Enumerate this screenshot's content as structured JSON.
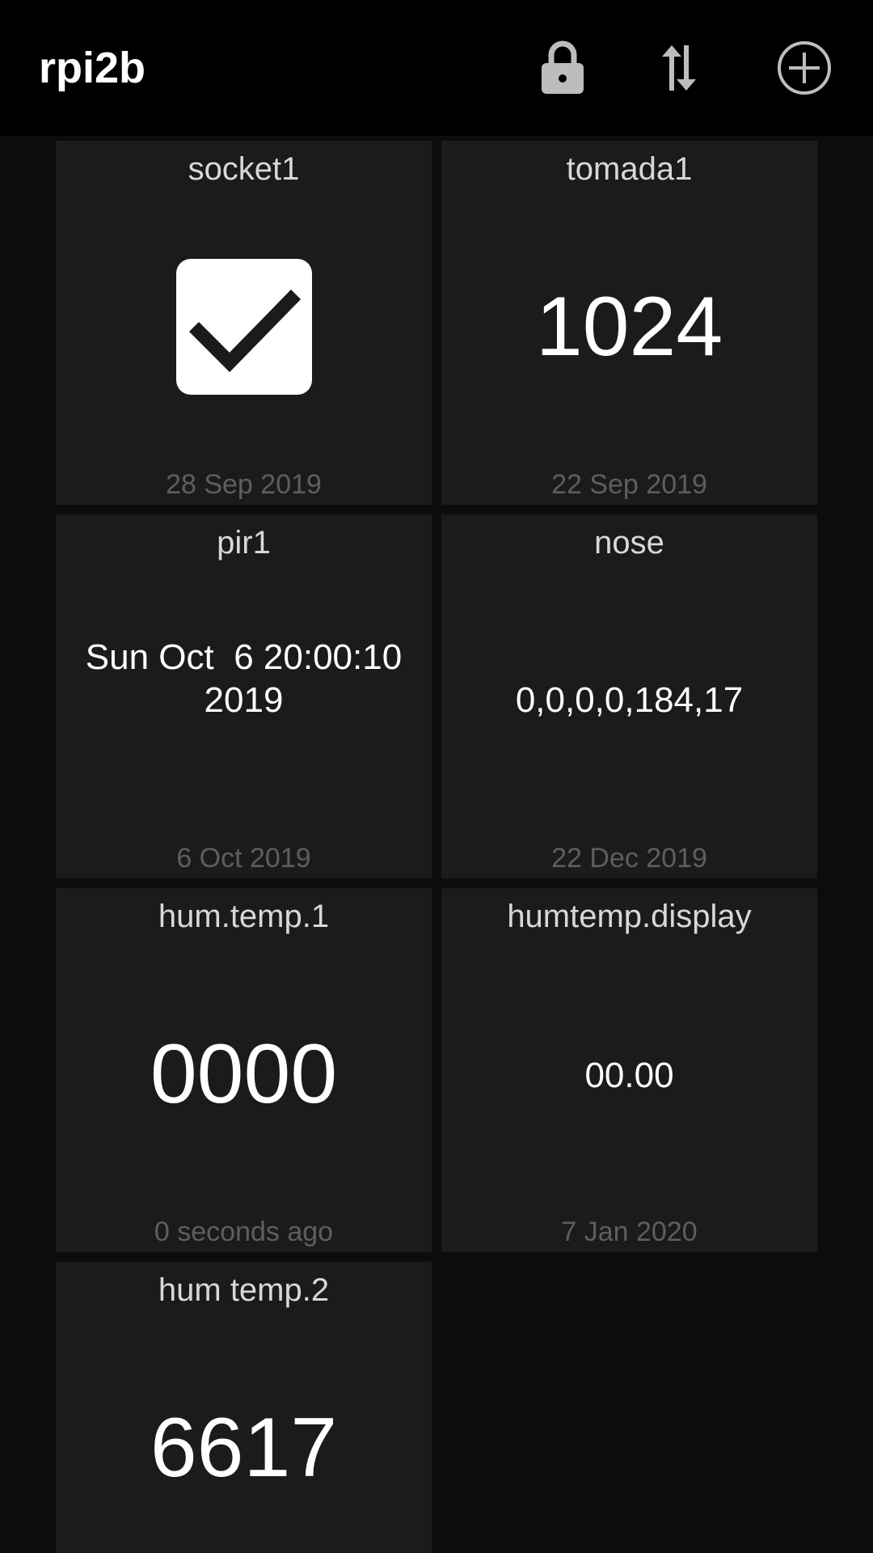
{
  "app_bar": {
    "title": "rpi2b",
    "icons": [
      "lock-icon",
      "swap-vertical-icon",
      "add-circle-icon"
    ]
  },
  "tiles": [
    {
      "title": "socket1",
      "value": "checked",
      "date": "28 Sep 2019",
      "widget": "switch"
    },
    {
      "title": "tomada1",
      "value": "1024",
      "date": "22 Sep 2019",
      "widget": "number"
    },
    {
      "title": "pir1",
      "value_line1": "Sun Oct  6 20:00:10",
      "value_line2": "2019",
      "date": "6 Oct 2019",
      "widget": "text"
    },
    {
      "title": "nose",
      "value": "0,0,0,0,184,17",
      "date": "22 Dec 2019",
      "widget": "text"
    },
    {
      "title": "hum.temp.1",
      "value": "0000",
      "date": "0 seconds ago",
      "widget": "number"
    },
    {
      "title": "humtemp.display",
      "value": "00.00",
      "date": "7 Jan 2020",
      "widget": "text"
    },
    {
      "title": "hum temp.2",
      "value": "6617",
      "widget": "number"
    }
  ],
  "colors": {
    "app_bar_bg": "#000000",
    "page_bg": "#0c0c0c",
    "tile_bg": "#1b1b1b",
    "title_text": "#d8d8d8",
    "date_text": "#5e5e5e",
    "value_text": "#ffffff"
  }
}
